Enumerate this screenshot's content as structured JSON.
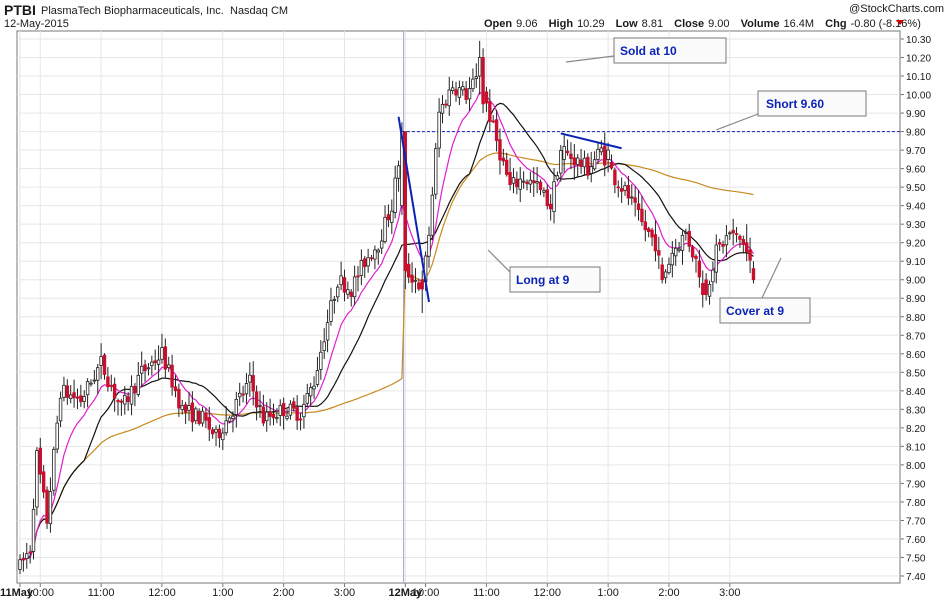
{
  "header": {
    "ticker": "PTBI",
    "company": "PlasmaTech Biopharmaceuticals, Inc.",
    "exchange": "Nasdaq CM",
    "date": "12-May-2015",
    "watermark": "@StockCharts.com",
    "open_label": "Open",
    "open": "9.06",
    "high_label": "High",
    "high": "10.29",
    "low_label": "Low",
    "low": "8.81",
    "close_label": "Close",
    "close": "9.00",
    "volume_label": "Volume",
    "volume": "16.4M",
    "chg_label": "Chg",
    "chg": "-0.80 (-8.16%)",
    "chg_arrow_color": "#cc0000"
  },
  "annotations": {
    "sold": "Sold at 10",
    "short": "Short 9.60",
    "long": "Long at 9",
    "cover": "Cover at 9"
  },
  "chart_data": {
    "type": "candlestick",
    "y_ticks": [
      "10.30",
      "10.20",
      "10.10",
      "10.00",
      "9.90",
      "9.80",
      "9.70",
      "9.60",
      "9.50",
      "9.40",
      "9.30",
      "9.20",
      "9.10",
      "9.00",
      "8.90",
      "8.80",
      "8.70",
      "8.60",
      "8.50",
      "8.40",
      "8.30",
      "8.20",
      "8.10",
      "8.00",
      "7.90",
      "7.80",
      "7.70",
      "7.60",
      "7.50",
      "7.40"
    ],
    "ylim": [
      7.36,
      10.35
    ],
    "x_labels": [
      {
        "label": "11May",
        "bar": 0,
        "bold": true
      },
      {
        "label": "10:00",
        "bar": 6
      },
      {
        "label": "11:00",
        "bar": 24
      },
      {
        "label": "12:00",
        "bar": 42
      },
      {
        "label": "1:00",
        "bar": 60
      },
      {
        "label": "2:00",
        "bar": 78
      },
      {
        "label": "3:00",
        "bar": 96
      },
      {
        "label": "12May",
        "bar": 114,
        "bold": true
      },
      {
        "label": "10:00",
        "bar": 120
      },
      {
        "label": "11:00",
        "bar": 138
      },
      {
        "label": "12:00",
        "bar": 156
      },
      {
        "label": "1:00",
        "bar": 174
      },
      {
        "label": "2:00",
        "bar": 192
      },
      {
        "label": "3:00",
        "bar": 210
      }
    ],
    "reference_line": 9.8,
    "colors": {
      "up": "#ffffff",
      "down": "#c8102e",
      "ma_short": "#e01ed0",
      "ma_mid": "#111111",
      "ma_long": "#c88a1e",
      "trend": "#0b22b7",
      "ref": "#0b22b7"
    },
    "price_points": [
      [
        0,
        7.45
      ],
      [
        3,
        7.55
      ],
      [
        5,
        8.05
      ],
      [
        8,
        7.7
      ],
      [
        12,
        8.4
      ],
      [
        18,
        8.35
      ],
      [
        24,
        8.55
      ],
      [
        30,
        8.3
      ],
      [
        36,
        8.5
      ],
      [
        42,
        8.6
      ],
      [
        48,
        8.3
      ],
      [
        54,
        8.25
      ],
      [
        58,
        8.15
      ],
      [
        63,
        8.3
      ],
      [
        68,
        8.45
      ],
      [
        72,
        8.25
      ],
      [
        78,
        8.3
      ],
      [
        83,
        8.28
      ],
      [
        87,
        8.45
      ],
      [
        90,
        8.7
      ],
      [
        94,
        9.0
      ],
      [
        98,
        8.95
      ],
      [
        102,
        9.1
      ],
      [
        106,
        9.2
      ],
      [
        110,
        9.4
      ],
      [
        113,
        9.75
      ],
      [
        114,
        9.05
      ],
      [
        117,
        9.0
      ],
      [
        119,
        8.95
      ],
      [
        121,
        9.25
      ],
      [
        124,
        9.9
      ],
      [
        128,
        10.05
      ],
      [
        132,
        10.0
      ],
      [
        136,
        10.1
      ],
      [
        138,
        9.95
      ],
      [
        141,
        9.75
      ],
      [
        145,
        9.5
      ],
      [
        149,
        9.55
      ],
      [
        153,
        9.5
      ],
      [
        157,
        9.4
      ],
      [
        160,
        9.7
      ],
      [
        164,
        9.65
      ],
      [
        168,
        9.6
      ],
      [
        172,
        9.7
      ],
      [
        176,
        9.55
      ],
      [
        180,
        9.45
      ],
      [
        184,
        9.3
      ],
      [
        188,
        9.2
      ],
      [
        190,
        9.0
      ],
      [
        193,
        9.15
      ],
      [
        197,
        9.25
      ],
      [
        200,
        9.1
      ],
      [
        203,
        8.95
      ],
      [
        206,
        9.15
      ],
      [
        210,
        9.25
      ],
      [
        214,
        9.2
      ],
      [
        217,
        9.05
      ]
    ],
    "overrides": {
      "113": [
        9.4,
        9.85,
        9.35,
        9.8
      ],
      "114": [
        9.8,
        9.8,
        8.95,
        9.05
      ],
      "119": [
        9.0,
        9.05,
        8.82,
        8.95
      ],
      "136": [
        10.1,
        10.29,
        10.0,
        10.2
      ],
      "137": [
        10.2,
        10.25,
        9.9,
        9.95
      ],
      "161": [
        9.65,
        9.78,
        9.58,
        9.72
      ],
      "174": [
        9.65,
        9.74,
        9.58,
        9.7
      ],
      "190": [
        9.08,
        9.12,
        8.98,
        9.0
      ],
      "202": [
        8.98,
        9.05,
        8.85,
        8.92
      ],
      "215": [
        9.2,
        9.3,
        9.1,
        9.15
      ],
      "217": [
        9.06,
        9.1,
        8.98,
        9.0
      ]
    },
    "series": [
      {
        "name": "",
        "kind": "ema_short"
      },
      {
        "name": "",
        "kind": "sma_mid"
      },
      {
        "name": "",
        "kind": "vwap"
      }
    ]
  }
}
